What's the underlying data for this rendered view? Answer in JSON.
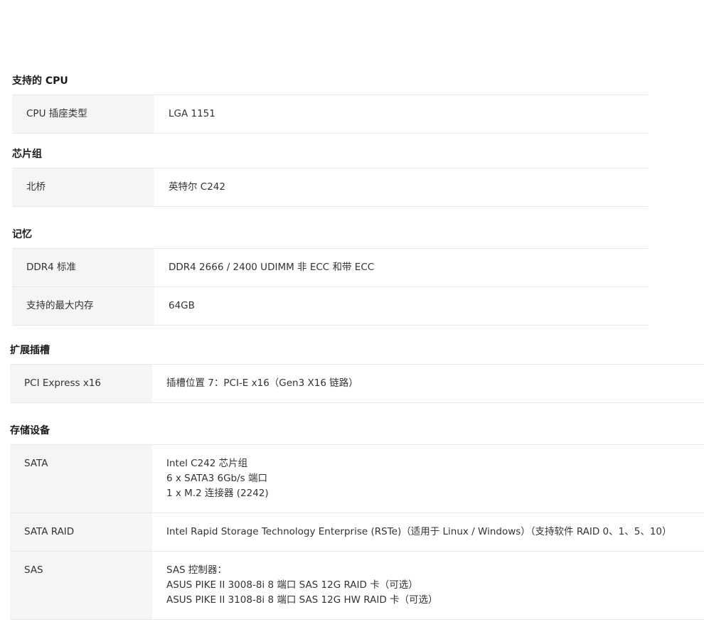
{
  "sections": [
    {
      "title": "支持的 CPU",
      "rows": [
        {
          "label": "CPU 插座类型",
          "lines": [
            "LGA 1151"
          ]
        }
      ]
    },
    {
      "title": "芯片组",
      "rows": [
        {
          "label": "北桥",
          "lines": [
            "英特尔 C242"
          ]
        }
      ]
    },
    {
      "title": "记忆",
      "rows": [
        {
          "label": "DDR4 标准",
          "lines": [
            "DDR4 2666 / 2400 UDIMM 非 ECC 和带 ECC"
          ]
        },
        {
          "label": "支持的最大内存",
          "lines": [
            "64GB"
          ]
        }
      ]
    },
    {
      "title": "扩展插槽",
      "rows": [
        {
          "label": "PCI Express x16",
          "lines": [
            "插槽位置 7：PCI-E x16（Gen3 X16 链路）"
          ]
        }
      ]
    },
    {
      "title": "存储设备",
      "rows": [
        {
          "label": "SATA",
          "lines": [
            "Intel C242 芯片组",
            "6 x SATA3 6Gb/s 端口",
            "1 x M.2 连接器 (2242)"
          ]
        },
        {
          "label": "SATA RAID",
          "lines": [
            "Intel Rapid Storage Technology Enterprise (RSTe)（适用于 Linux / Windows）（支持软件 RAID 0、1、5、10）"
          ]
        },
        {
          "label": "SAS",
          "lines": [
            "SAS 控制器：",
            "ASUS PIKE II 3008-8i 8 端口 SAS 12G RAID 卡（可选）",
            "ASUS PIKE II 3108-8i 8 端口 SAS 12G HW RAID 卡（可选）"
          ]
        }
      ]
    }
  ]
}
